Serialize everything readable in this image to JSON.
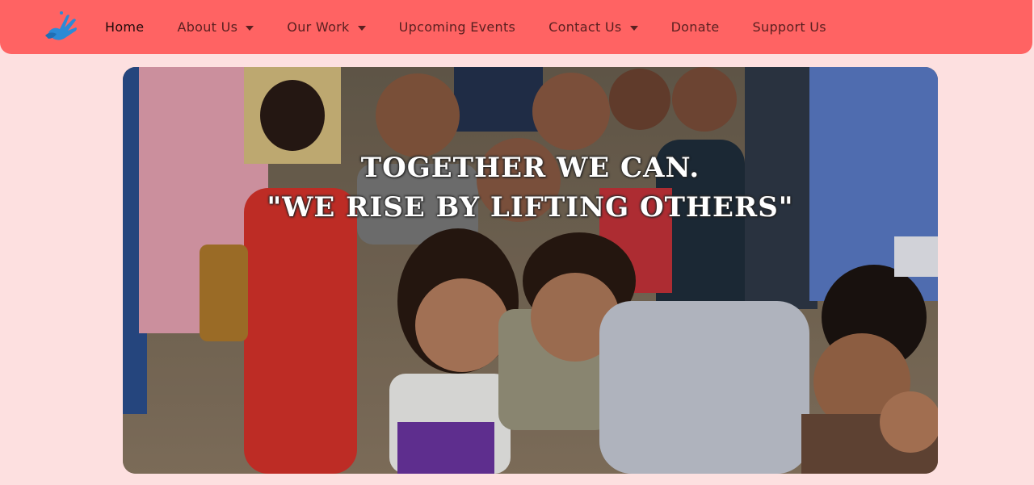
{
  "nav": {
    "logo_icon": "hand-dove-icon",
    "items": [
      {
        "label": "Home",
        "active": true,
        "dropdown": false
      },
      {
        "label": "About Us",
        "active": false,
        "dropdown": true
      },
      {
        "label": "Our Work",
        "active": false,
        "dropdown": true
      },
      {
        "label": "Upcoming Events",
        "active": false,
        "dropdown": false
      },
      {
        "label": "Contact Us",
        "active": false,
        "dropdown": true
      },
      {
        "label": "Donate",
        "active": false,
        "dropdown": false
      },
      {
        "label": "Support Us",
        "active": false,
        "dropdown": false
      }
    ]
  },
  "hero": {
    "line1": "TOGETHER WE CAN.",
    "line2": "\"WE RISE BY LIFTING OTHERS\""
  },
  "colors": {
    "nav_bg": "#ff6363",
    "page_bg": "#fde0e0",
    "logo_blue": "#2b8ad6"
  }
}
